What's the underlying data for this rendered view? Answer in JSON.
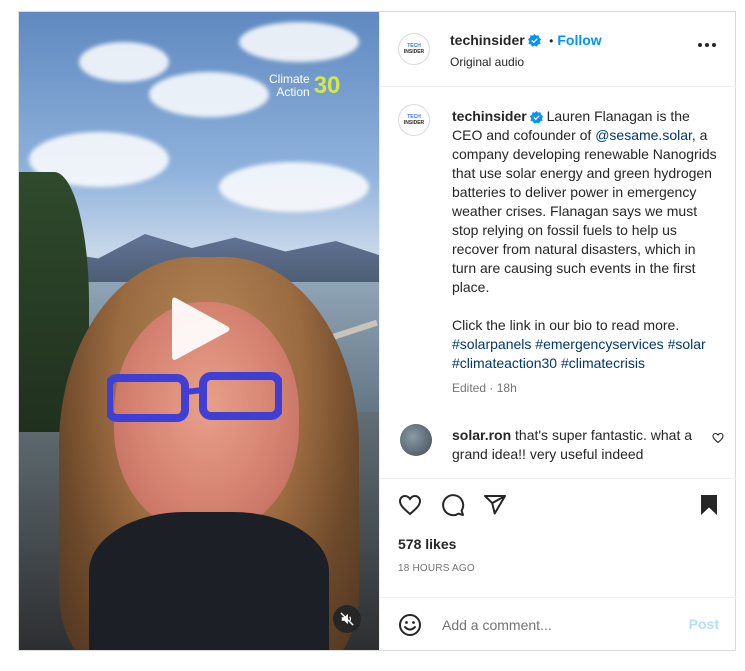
{
  "post": {
    "author": "techinsider",
    "author_avatar_line1": "TECH",
    "author_avatar_line2": "INSIDER",
    "follow_label": "Follow",
    "separator": "•",
    "audio": "Original audio",
    "more_icon": "more-horizontal-icon"
  },
  "media": {
    "badge_line1": "Climate",
    "badge_line2": "Action",
    "badge_number": "30",
    "play_icon": "play-icon",
    "mute_icon": "muted-speaker-icon"
  },
  "caption": {
    "author": "techinsider",
    "text_before_mention": "Lauren Flanagan is the CEO and cofounder of ",
    "mention": "@sesame.solar",
    "text_after_mention": ", a company developing renewable Nanogrids that use solar energy and green hydrogen batteries to deliver power in emergency weather crises. Flanagan says we must stop relying on fossil fuels to help us recover from natural disasters, which in turn are causing such events in the first place.",
    "cta": "Click the link in our bio to read more.",
    "hashtags": [
      "#solarpanels",
      "#emergencyservices",
      "#solar",
      "#climateaction30",
      "#climatecrisis"
    ],
    "edited": "Edited",
    "dot": "·",
    "time": "18h"
  },
  "comment": {
    "user": "solar.ron",
    "text": "that's super fantastic. what a grand idea!! very useful indeed"
  },
  "actions": {
    "like_icon": "heart-icon",
    "comment_icon": "comment-icon",
    "share_icon": "share-icon",
    "save_icon": "bookmark-icon"
  },
  "stats": {
    "likes": "578 likes",
    "time_ago": "18 HOURS AGO"
  },
  "add_comment": {
    "placeholder": "Add a comment...",
    "post_label": "Post",
    "emoji_icon": "emoji-icon"
  },
  "colors": {
    "accent": "#0095f6",
    "link": "#00376b",
    "muted": "#737373",
    "border": "#dbdbdb",
    "badge_number": "#d4e84a",
    "post_disabled": "#b2dffc"
  }
}
